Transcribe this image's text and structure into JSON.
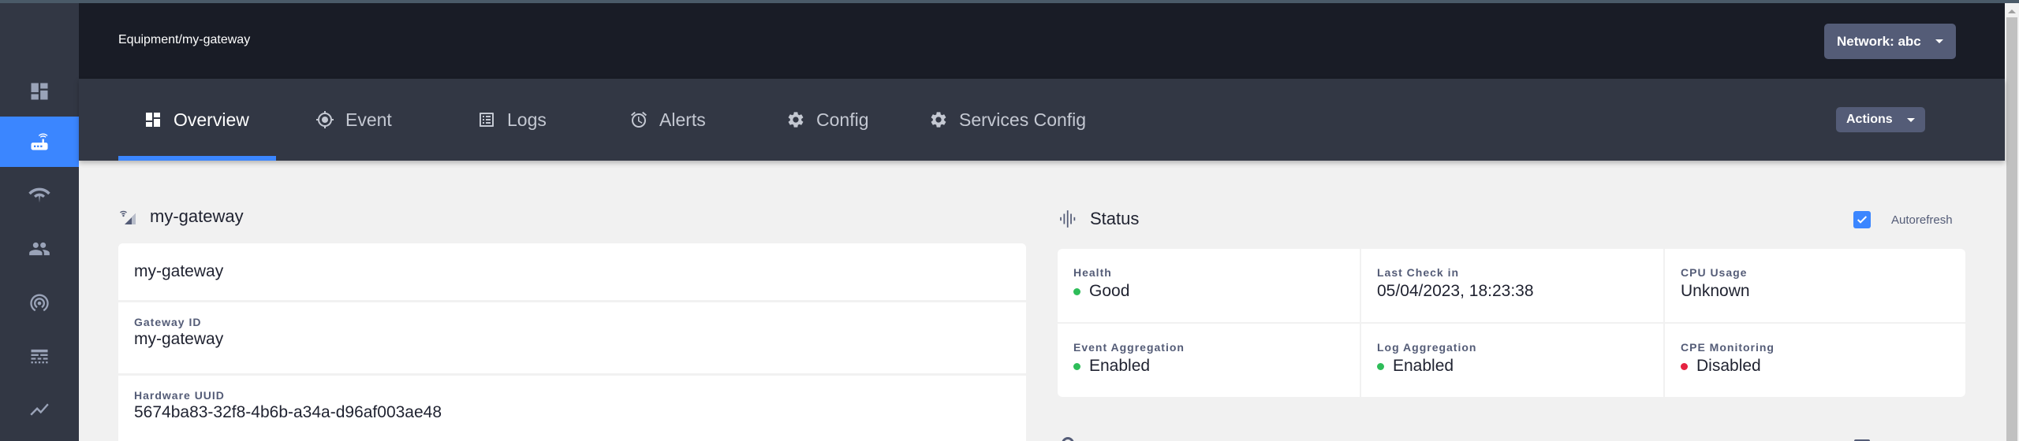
{
  "header": {
    "breadcrumb": "Equipment/my-gateway",
    "network_button": "Network: abc"
  },
  "sidebar": {
    "items": [
      {
        "name": "dashboard",
        "icon": "dashboard-icon",
        "active": false
      },
      {
        "name": "equipment",
        "icon": "router-icon",
        "active": true
      },
      {
        "name": "network",
        "icon": "wifi-tethering-icon",
        "active": false
      },
      {
        "name": "subscribers",
        "icon": "people-icon",
        "active": false
      },
      {
        "name": "traffic",
        "icon": "broadcast-icon",
        "active": false
      },
      {
        "name": "policies",
        "icon": "table-icon",
        "active": false
      },
      {
        "name": "metrics",
        "icon": "trending-icon",
        "active": false
      }
    ]
  },
  "tabs": {
    "items": [
      {
        "label": "Overview",
        "icon": "dashboard-icon",
        "active": true
      },
      {
        "label": "Event",
        "icon": "target-icon",
        "active": false
      },
      {
        "label": "Logs",
        "icon": "list-icon",
        "active": false
      },
      {
        "label": "Alerts",
        "icon": "alarm-icon",
        "active": false
      },
      {
        "label": "Config",
        "icon": "gear-icon",
        "active": false
      },
      {
        "label": "Services Config",
        "icon": "gear-icon",
        "active": false
      }
    ],
    "actions_button": "Actions"
  },
  "gateway": {
    "title": "my-gateway",
    "name": "my-gateway",
    "fields": [
      {
        "label": "Gateway ID",
        "value": "my-gateway"
      },
      {
        "label": "Hardware UUID",
        "value": "5674ba83-32f8-4b6b-a34a-d96af003ae48"
      }
    ]
  },
  "status": {
    "title": "Status",
    "autorefresh_label": "Autorefresh",
    "autorefresh_checked": true,
    "cells": [
      {
        "label": "Health",
        "value": "Good",
        "indicator": "#2ebd59"
      },
      {
        "label": "Last Check in",
        "value": "05/04/2023, 18:23:38",
        "indicator": null
      },
      {
        "label": "CPU Usage",
        "value": "Unknown",
        "indicator": null
      },
      {
        "label": "Event Aggregation",
        "value": "Enabled",
        "indicator": "#2ebd59"
      },
      {
        "label": "Log Aggregation",
        "value": "Enabled",
        "indicator": "#2ebd59"
      },
      {
        "label": "CPE Monitoring",
        "value": "Disabled",
        "indicator": "#e52240"
      }
    ]
  },
  "colors": {
    "accent": "#3b86ff",
    "header_bg": "#191c26",
    "nav_bg": "#323744",
    "good": "#2ebd59",
    "bad": "#e52240"
  }
}
